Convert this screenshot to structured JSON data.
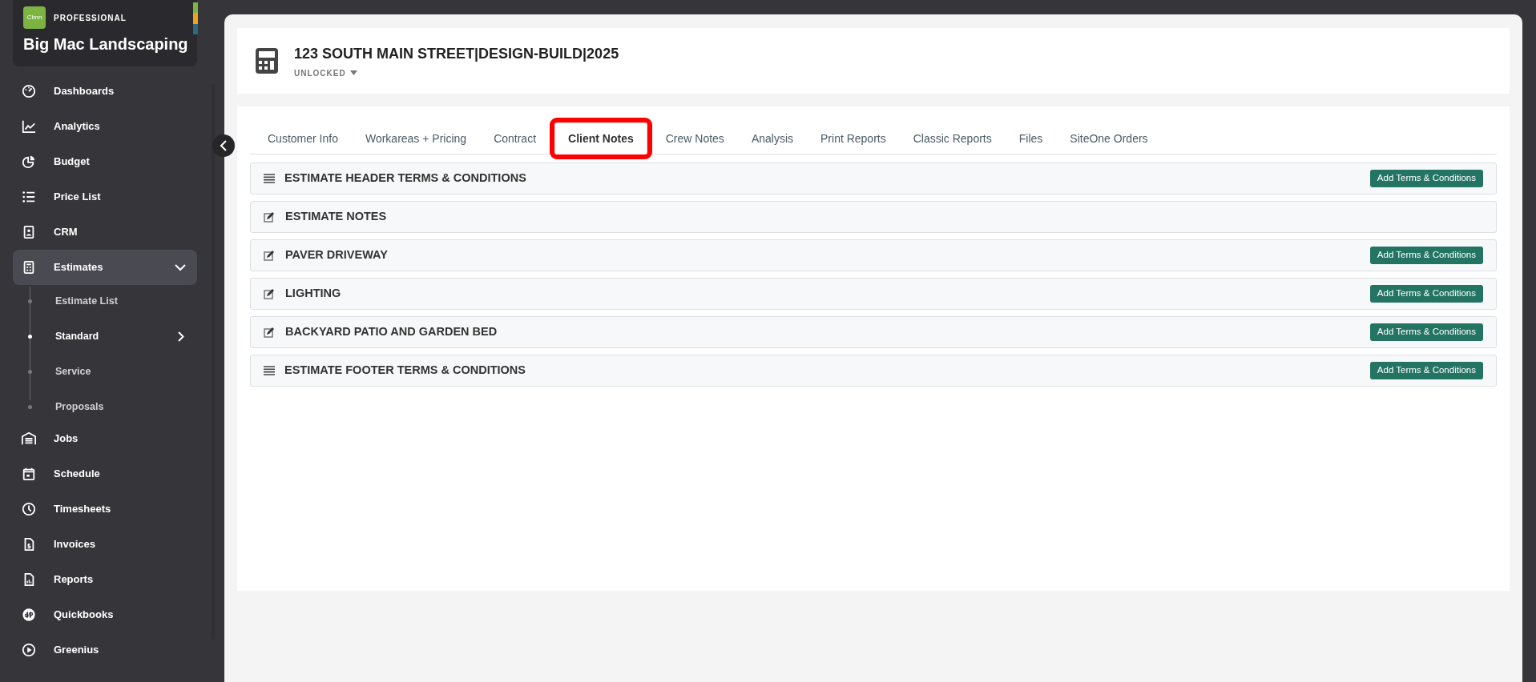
{
  "sidebar": {
    "badge": "Clmn",
    "edition": "PROFESSIONAL",
    "company": "Big Mac Landscaping",
    "items": [
      {
        "label": "Dashboards",
        "selected": false
      },
      {
        "label": "Analytics",
        "selected": false
      },
      {
        "label": "Budget",
        "selected": false
      },
      {
        "label": "Price List",
        "selected": false
      },
      {
        "label": "CRM",
        "selected": false
      },
      {
        "label": "Estimates",
        "selected": true,
        "expanded": true,
        "children": [
          {
            "label": "Estimate List",
            "selected": false,
            "has_submenu": false
          },
          {
            "label": "Standard",
            "selected": true,
            "has_submenu": true
          },
          {
            "label": "Service",
            "selected": false,
            "has_submenu": false
          },
          {
            "label": "Proposals",
            "selected": false,
            "has_submenu": false
          }
        ]
      },
      {
        "label": "Jobs",
        "selected": false
      },
      {
        "label": "Schedule",
        "selected": false
      },
      {
        "label": "Timesheets",
        "selected": false
      },
      {
        "label": "Invoices",
        "selected": false
      },
      {
        "label": "Reports",
        "selected": false
      },
      {
        "label": "Quickbooks",
        "selected": false
      },
      {
        "label": "Greenius",
        "selected": false
      }
    ]
  },
  "header": {
    "title": "123 SOUTH MAIN STREET|DESIGN-BUILD|2025",
    "status": "UNLOCKED"
  },
  "tabs": [
    {
      "label": "Customer Info",
      "selected": false,
      "highlighted": false
    },
    {
      "label": "Workareas + Pricing",
      "selected": false,
      "highlighted": false
    },
    {
      "label": "Contract",
      "selected": false,
      "highlighted": false
    },
    {
      "label": "Client Notes",
      "selected": true,
      "highlighted": true
    },
    {
      "label": "Crew Notes",
      "selected": false,
      "highlighted": false
    },
    {
      "label": "Analysis",
      "selected": false,
      "highlighted": false
    },
    {
      "label": "Print Reports",
      "selected": false,
      "highlighted": false
    },
    {
      "label": "Classic Reports",
      "selected": false,
      "highlighted": false
    },
    {
      "label": "Files",
      "selected": false,
      "highlighted": false
    },
    {
      "label": "SiteOne Orders",
      "selected": false,
      "highlighted": false
    }
  ],
  "sections": [
    {
      "kind": "terms",
      "title": "ESTIMATE HEADER TERMS & CONDITIONS",
      "button": "Add Terms & Conditions"
    },
    {
      "kind": "notes",
      "title": "ESTIMATE NOTES"
    },
    {
      "kind": "notes",
      "title": "PAVER DRIVEWAY",
      "button": "Add Terms & Conditions"
    },
    {
      "kind": "notes",
      "title": "LIGHTING",
      "button": "Add Terms & Conditions"
    },
    {
      "kind": "notes",
      "title": "BACKYARD PATIO AND GARDEN BED",
      "button": "Add Terms & Conditions"
    },
    {
      "kind": "terms",
      "title": "ESTIMATE FOOTER TERMS & CONDITIONS",
      "button": "Add Terms & Conditions"
    }
  ]
}
